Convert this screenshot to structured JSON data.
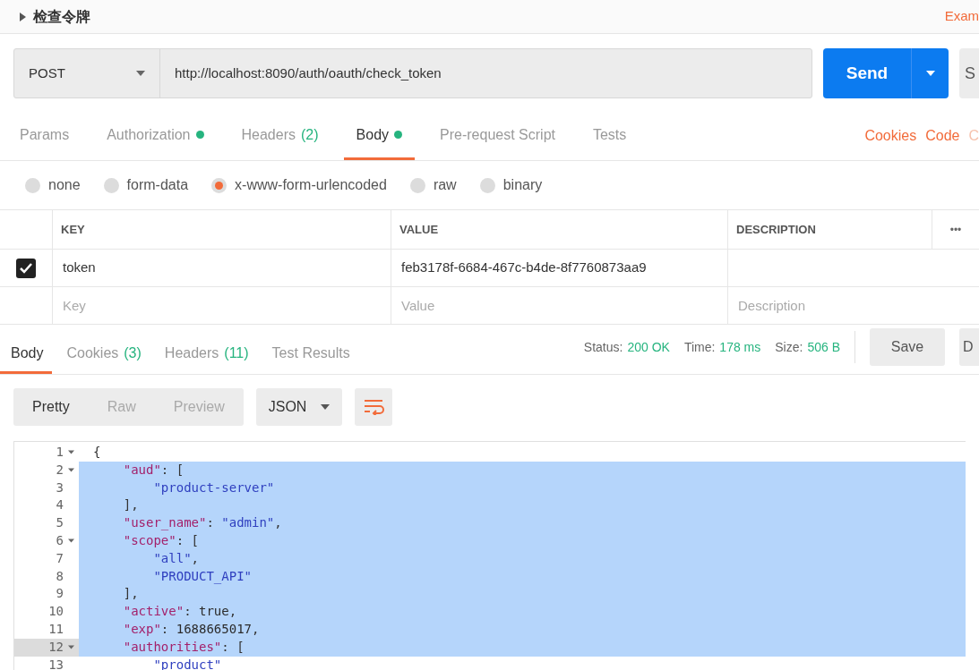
{
  "request_title": {
    "label": "检查令牌",
    "expanded": false
  },
  "examples_link": "Exam",
  "method": "POST",
  "url": "http://localhost:8090/auth/oauth/check_token",
  "send_button": "Send",
  "save_edge": "S",
  "request_tabs": [
    {
      "label": "Params",
      "dot": false,
      "selected": false
    },
    {
      "label": "Authorization",
      "dot": true,
      "selected": false
    },
    {
      "label": "Headers",
      "count": "(2)",
      "dot": false,
      "selected": false
    },
    {
      "label": "Body",
      "dot": true,
      "selected": true
    },
    {
      "label": "Pre-request Script",
      "dot": false,
      "selected": false
    },
    {
      "label": "Tests",
      "dot": false,
      "selected": false
    }
  ],
  "request_links": [
    "Cookies",
    "Code",
    "C"
  ],
  "body_types": [
    {
      "label": "none",
      "selected": false
    },
    {
      "label": "form-data",
      "selected": false
    },
    {
      "label": "x-www-form-urlencoded",
      "selected": true
    },
    {
      "label": "raw",
      "selected": false
    },
    {
      "label": "binary",
      "selected": false
    }
  ],
  "params_table": {
    "columns": [
      "KEY",
      "VALUE",
      "DESCRIPTION"
    ],
    "more": "•••",
    "rows": [
      {
        "checked": true,
        "key": "token",
        "value": "feb3178f-6684-467c-b4de-8f7760873aa9"
      }
    ],
    "new_row": {
      "key": {
        "placeholder": "Key"
      },
      "value": {
        "placeholder": "Value"
      },
      "description": {
        "placeholder": "Description"
      }
    }
  },
  "response_tabs": [
    {
      "label": "Body",
      "selected": true
    },
    {
      "label": "Cookies",
      "count": "(3)",
      "selected": false
    },
    {
      "label": "Headers",
      "count": "(11)",
      "selected": false
    },
    {
      "label": "Test Results",
      "selected": false
    }
  ],
  "status": [
    {
      "label": "Status:",
      "value": "200 OK"
    },
    {
      "label": "Time:",
      "value": "178 ms"
    },
    {
      "label": "Size:",
      "value": "506 B"
    }
  ],
  "save_button": "Save",
  "edge_button": "D",
  "view_modes": [
    {
      "label": "Pretty",
      "selected": true
    },
    {
      "label": "Raw",
      "selected": false
    },
    {
      "label": "Preview",
      "selected": false
    }
  ],
  "format": "JSON",
  "code_lines": [
    {
      "number": "1",
      "fold": true,
      "selected": false,
      "current": false,
      "parts": [
        {
          "kind": "punct",
          "text": "{"
        }
      ]
    },
    {
      "number": "2",
      "fold": true,
      "selected": true,
      "current": false,
      "parts": [
        {
          "kind": "key",
          "text": "    \"aud\""
        },
        {
          "kind": "punct",
          "text": ": ["
        }
      ]
    },
    {
      "number": "3",
      "fold": false,
      "selected": true,
      "current": false,
      "parts": [
        {
          "kind": "string",
          "text": "        \"product-server\""
        }
      ]
    },
    {
      "number": "4",
      "fold": false,
      "selected": true,
      "current": false,
      "parts": [
        {
          "kind": "punct",
          "text": "    ],"
        }
      ]
    },
    {
      "number": "5",
      "fold": false,
      "selected": true,
      "current": false,
      "parts": [
        {
          "kind": "key",
          "text": "    \"user_name\""
        },
        {
          "kind": "punct",
          "text": ": "
        },
        {
          "kind": "string",
          "text": "\"admin\""
        },
        {
          "kind": "punct",
          "text": ","
        }
      ]
    },
    {
      "number": "6",
      "fold": true,
      "selected": true,
      "current": false,
      "parts": [
        {
          "kind": "key",
          "text": "    \"scope\""
        },
        {
          "kind": "punct",
          "text": ": ["
        }
      ]
    },
    {
      "number": "7",
      "fold": false,
      "selected": true,
      "current": false,
      "parts": [
        {
          "kind": "string",
          "text": "        \"all\""
        },
        {
          "kind": "punct",
          "text": ","
        }
      ]
    },
    {
      "number": "8",
      "fold": false,
      "selected": true,
      "current": false,
      "parts": [
        {
          "kind": "string",
          "text": "        \"PRODUCT_API\""
        }
      ]
    },
    {
      "number": "9",
      "fold": false,
      "selected": true,
      "current": false,
      "parts": [
        {
          "kind": "punct",
          "text": "    ],"
        }
      ]
    },
    {
      "number": "10",
      "fold": false,
      "selected": true,
      "current": false,
      "parts": [
        {
          "kind": "key",
          "text": "    \"active\""
        },
        {
          "kind": "punct",
          "text": ": "
        },
        {
          "kind": "literal",
          "text": "true"
        },
        {
          "kind": "punct",
          "text": ","
        }
      ]
    },
    {
      "number": "11",
      "fold": false,
      "selected": true,
      "current": false,
      "parts": [
        {
          "kind": "key",
          "text": "    \"exp\""
        },
        {
          "kind": "punct",
          "text": ": "
        },
        {
          "kind": "literal",
          "text": "1688665017"
        },
        {
          "kind": "punct",
          "text": ","
        }
      ]
    },
    {
      "number": "12",
      "fold": true,
      "selected": true,
      "current": true,
      "parts": [
        {
          "kind": "key",
          "text": "    \"authorities\""
        },
        {
          "kind": "punct",
          "text": ": ["
        }
      ]
    },
    {
      "number": "13",
      "fold": false,
      "selected": false,
      "current": false,
      "parts": [
        {
          "kind": "string",
          "text": "        \"product\""
        }
      ]
    }
  ]
}
